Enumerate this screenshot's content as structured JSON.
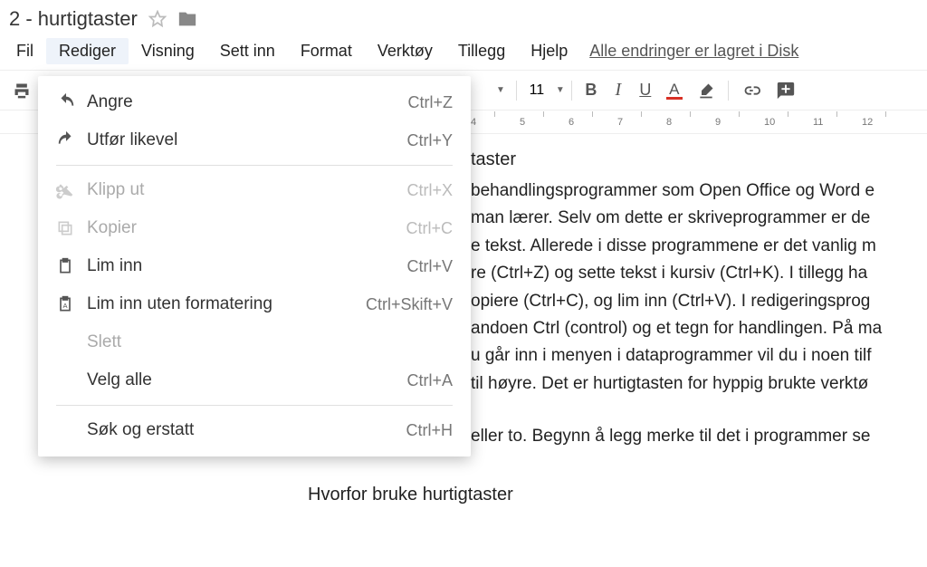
{
  "doc": {
    "title": "2 - hurtigtaster"
  },
  "menubar": {
    "items": [
      {
        "label": "Fil"
      },
      {
        "label": "Rediger"
      },
      {
        "label": "Visning"
      },
      {
        "label": "Sett inn"
      },
      {
        "label": "Format"
      },
      {
        "label": "Verktøy"
      },
      {
        "label": "Tillegg"
      },
      {
        "label": "Hjelp"
      }
    ],
    "autosave": "Alle endringer er lagret i Disk",
    "active": 1
  },
  "toolbar": {
    "font_size": "11"
  },
  "ruler": {
    "start": 4,
    "end": 12
  },
  "dropdown": {
    "items": [
      {
        "type": "item",
        "icon": "undo",
        "label": "Angre",
        "shortcut": "Ctrl+Z"
      },
      {
        "type": "item",
        "icon": "redo",
        "label": "Utfør likevel",
        "shortcut": "Ctrl+Y"
      },
      {
        "type": "divider"
      },
      {
        "type": "item",
        "icon": "cut",
        "label": "Klipp ut",
        "shortcut": "Ctrl+X",
        "disabled": true
      },
      {
        "type": "item",
        "icon": "copy",
        "label": "Kopier",
        "shortcut": "Ctrl+C",
        "disabled": true
      },
      {
        "type": "item",
        "icon": "paste",
        "label": "Lim inn",
        "shortcut": "Ctrl+V"
      },
      {
        "type": "item",
        "icon": "paste-plain",
        "label": "Lim inn uten formatering",
        "shortcut": "Ctrl+Skift+V"
      },
      {
        "type": "item",
        "icon": "",
        "label": "Slett",
        "shortcut": "",
        "disabled": true
      },
      {
        "type": "item",
        "icon": "",
        "label": "Velg alle",
        "shortcut": "Ctrl+A"
      },
      {
        "type": "divider"
      },
      {
        "type": "item",
        "icon": "",
        "label": "Søk og erstatt",
        "shortcut": "Ctrl+H"
      }
    ]
  },
  "body": {
    "h1": "taster",
    "p1": "behandlingsprogrammer som Open Office og Word e",
    "p2": "man lærer. Selv om dette er skriveprogrammer er de",
    "p3": "e tekst. Allerede i disse programmene er det vanlig m",
    "p4": "re (Ctrl+Z) og sette tekst i kursiv (Ctrl+K). I tillegg ha",
    "p5": "opiere (Ctrl+C), og lim inn (Ctrl+V). I redigeringsprog",
    "p6": "andoen Ctrl (control) og et tegn for handlingen. På ma",
    "p7": "u går inn i menyen i dataprogrammer vil du i noen tilf",
    "p8": "til høyre. Det er hurtigtasten for hyppig brukte verktø",
    "p9": "eller to. Begynn å legg merke til det i programmer se",
    "h2": "Hvorfor bruke hurtigtaster"
  }
}
